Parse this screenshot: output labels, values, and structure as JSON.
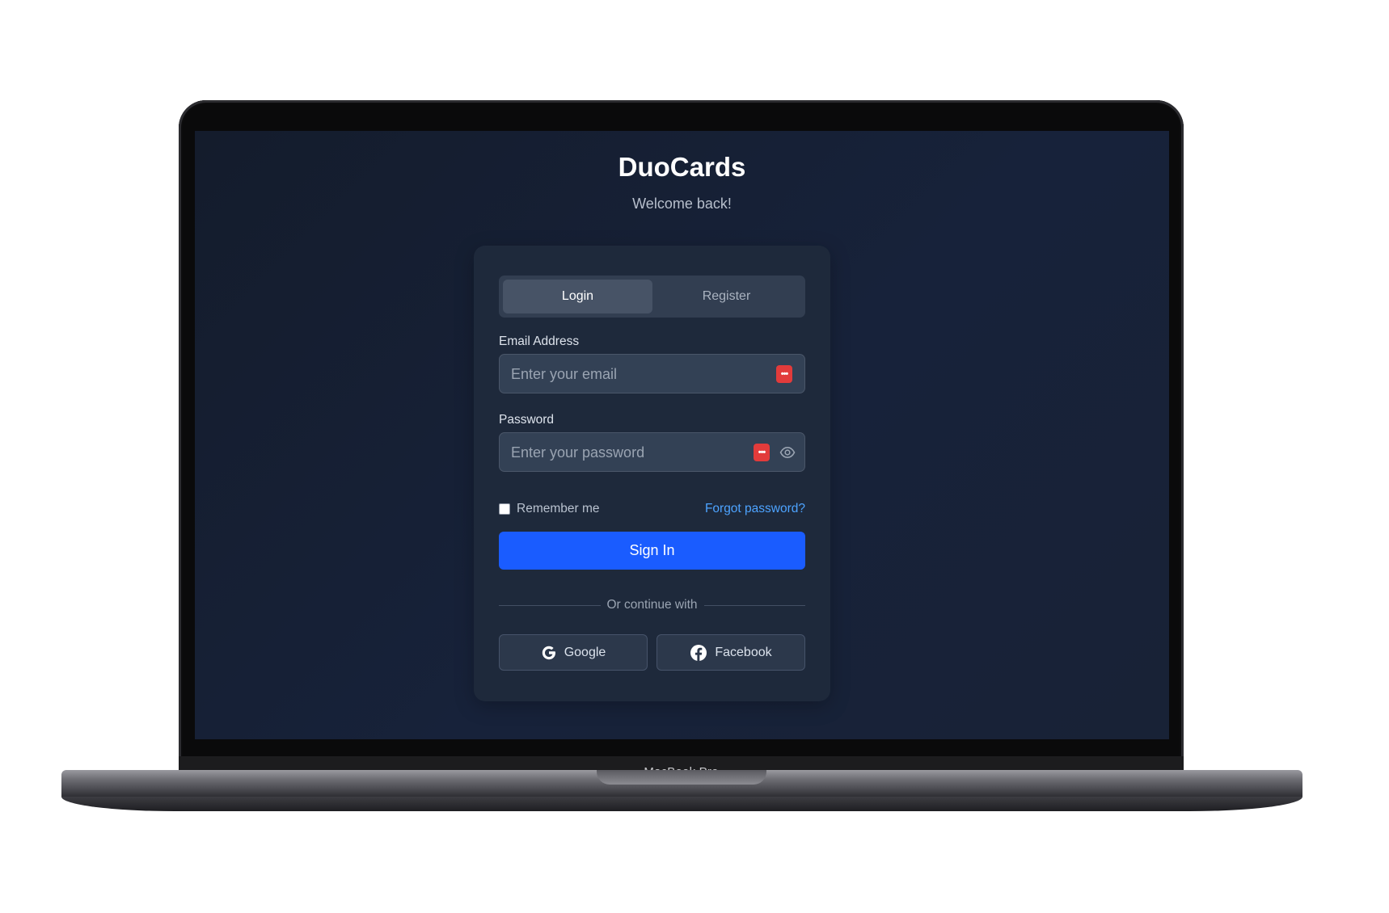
{
  "device": {
    "label": "MacBook Pro"
  },
  "app": {
    "name": "DuoCards",
    "subtitle": "Welcome back!"
  },
  "tabs": [
    {
      "label": "Login",
      "active": true
    },
    {
      "label": "Register",
      "active": false
    }
  ],
  "form": {
    "email": {
      "label": "Email Address",
      "placeholder": "Enter your email",
      "value": ""
    },
    "password": {
      "label": "Password",
      "placeholder": "Enter your password",
      "value": ""
    },
    "remember_label": "Remember me",
    "remember_checked": false,
    "forgot_label": "Forgot password?",
    "submit_label": "Sign In"
  },
  "divider_label": "Or continue with",
  "social": [
    {
      "label": "Google",
      "icon": "google-icon"
    },
    {
      "label": "Facebook",
      "icon": "facebook-icon"
    }
  ],
  "colors": {
    "background": "#161f33",
    "card": "#1e293b",
    "primary": "#1a5cff",
    "link": "#4da3ff",
    "password_manager_badge": "#e23b3b"
  }
}
